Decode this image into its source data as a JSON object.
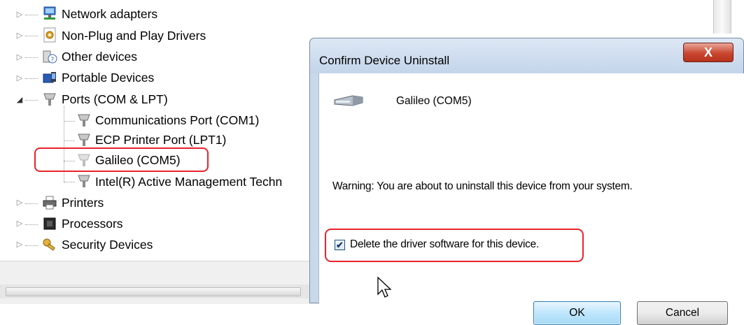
{
  "tree": {
    "items": [
      {
        "label": "Network adapters",
        "icon": "network-adapter-icon",
        "expanded": false
      },
      {
        "label": "Non-Plug and Play Drivers",
        "icon": "driver-icon",
        "expanded": false
      },
      {
        "label": "Other devices",
        "icon": "unknown-device-icon",
        "expanded": false
      },
      {
        "label": "Portable Devices",
        "icon": "portable-device-icon",
        "expanded": false
      },
      {
        "label": "Ports (COM & LPT)",
        "icon": "port-icon",
        "expanded": true
      },
      {
        "label": "Communications Port (COM1)",
        "icon": "port-icon"
      },
      {
        "label": "ECP Printer Port (LPT1)",
        "icon": "port-icon"
      },
      {
        "label": "Galileo (COM5)",
        "icon": "port-icon",
        "highlighted": true
      },
      {
        "label": "Intel(R) Active Management Techn",
        "icon": "port-icon"
      },
      {
        "label": "Printers",
        "icon": "printer-icon",
        "expanded": false
      },
      {
        "label": "Processors",
        "icon": "processor-icon",
        "expanded": false
      },
      {
        "label": "Security Devices",
        "icon": "security-key-icon",
        "expanded": false
      }
    ]
  },
  "dialog": {
    "title": "Confirm Device Uninstall",
    "close_label": "X",
    "device_name": "Galileo (COM5)",
    "warning": "Warning: You are about to uninstall this device from your system.",
    "checkbox_label": "Delete the driver software for this device.",
    "checkbox_checked": true,
    "ok_label": "OK",
    "cancel_label": "Cancel"
  },
  "colors": {
    "highlight": "#e8232c",
    "dialog_frame": "#c9d9ec",
    "ok_button": "#bee6fd"
  }
}
